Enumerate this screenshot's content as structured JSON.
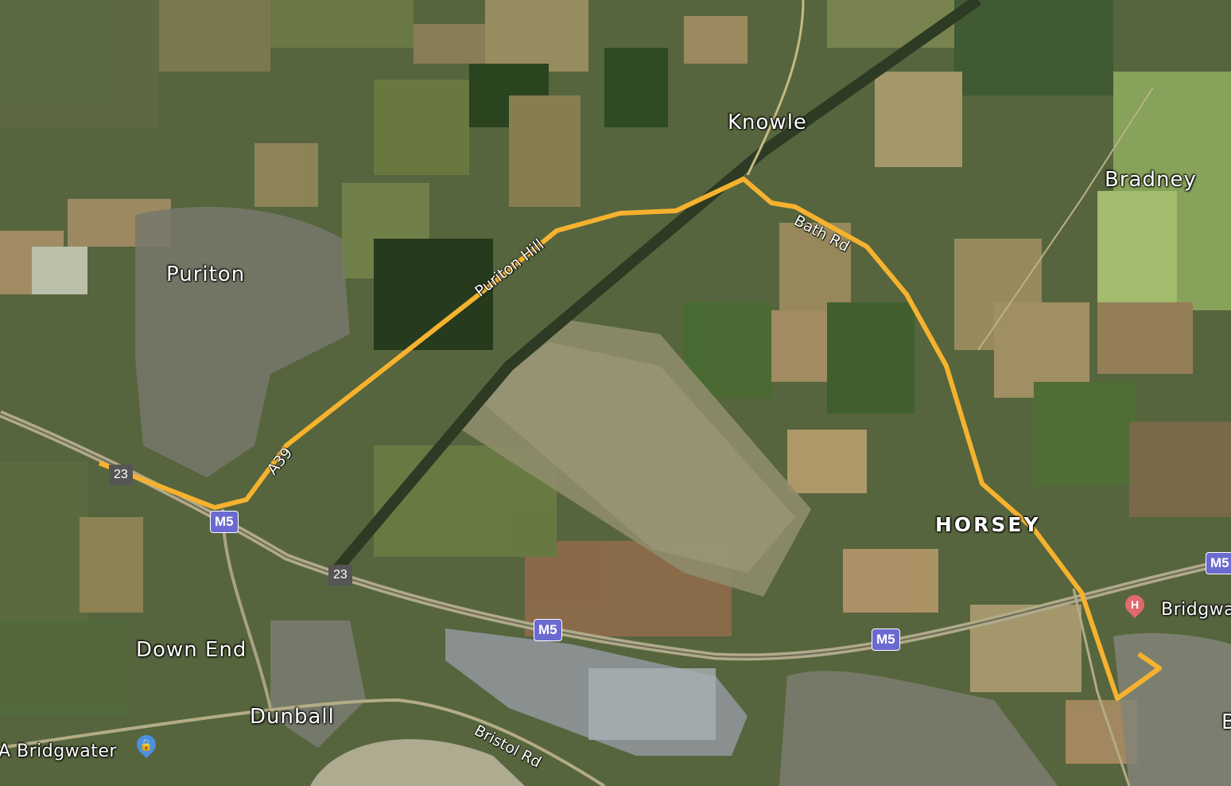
{
  "map": {
    "type": "satellite",
    "route_color": "#f6b22e",
    "motorway_shield_color": "#6a6ad0",
    "places": {
      "knowle": "Knowle",
      "bradney": "Bradney",
      "puriton": "Puriton",
      "horsey": "HORSEY",
      "down_end": "Down End",
      "dunball": "Dunball",
      "bridgwater_hospital": "Bridgwa",
      "bridgwater_poi": "A Bridgwater",
      "edge_letter": "B"
    },
    "roads": {
      "puriton_hill": "Puriton Hill",
      "bath_rd": "Bath Rd",
      "a39": "A39",
      "bristol_rd": "Bristol Rd"
    },
    "shields": {
      "m5_1": "M5",
      "m5_2": "M5",
      "m5_3": "M5",
      "m5_4": "M5",
      "j23_1": "23",
      "j23_2": "23"
    },
    "icons": {
      "hospital": "hospital-pin-icon",
      "poi": "lock-pin-icon"
    },
    "hospital_pin_letter": "H"
  }
}
